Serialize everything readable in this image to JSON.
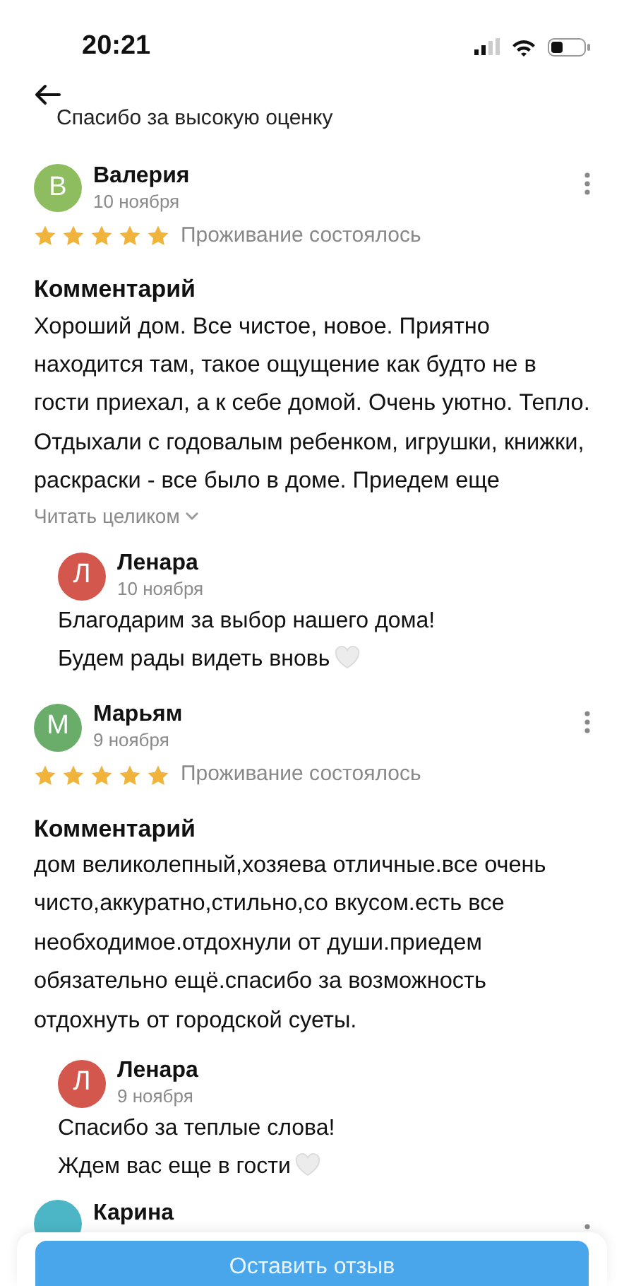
{
  "status_bar": {
    "time": "20:21"
  },
  "partial_reply_text": "Спасибо за высокую оценку",
  "reviews": [
    {
      "avatar_letter": "В",
      "color": "#8dbd5f",
      "name": "Валерия",
      "date": "10 ноября",
      "stars": 5,
      "stay_status": "Проживание состоялось",
      "comment_heading": "Комментарий",
      "comment": "Хороший дом. Все чистое, новое. Приятно находится там, такое ощущение как будто не в гости приехал, а к себе домой. Очень уютно. Тепло. Отдыхали с годовалым ребенком, игрушки, книжки, раскраски - все было в доме. Приедем еще",
      "read_more": "Читать целиком",
      "reply": {
        "avatar_letter": "Л",
        "color": "#d4574e",
        "name": "Ленара",
        "date": "10 ноября",
        "lines": [
          {
            "text": "Благодарим за выбор нашего дома!",
            "heart": false
          },
          {
            "text": "Будем рады видеть вновь",
            "heart": true
          }
        ]
      }
    },
    {
      "avatar_letter": "М",
      "color": "#6aad6a",
      "name": "Марьям",
      "date": "9 ноября",
      "stars": 5,
      "stay_status": "Проживание состоялось",
      "comment_heading": "Комментарий",
      "comment": "дом великолепный,хозяева отличные.все очень чисто,аккуратно,стильно,со вкусом.есть все необходимое.отдохнули от души.приедем обязательно ещё.спасибо за возможность отдохнуть от городской суеты.",
      "reply": {
        "avatar_letter": "Л",
        "color": "#d4574e",
        "name": "Ленара",
        "date": "9 ноября",
        "lines": [
          {
            "text": "Спасибо за теплые слова!",
            "heart": false
          },
          {
            "text": "Ждем вас еще в гости",
            "heart": true
          }
        ]
      }
    }
  ],
  "partial_review": {
    "name": "Карина",
    "color": "#4cb6c6"
  },
  "bottom_button": "Оставить отзыв"
}
